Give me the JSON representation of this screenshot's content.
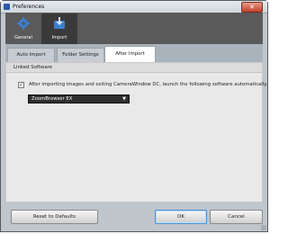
{
  "window": {
    "title": "Preferences",
    "close_glyph": "✕"
  },
  "main_tabs": [
    {
      "label": "General",
      "icon": "gear-icon"
    },
    {
      "label": "Import",
      "icon": "import-icon"
    }
  ],
  "sub_tabs": [
    {
      "label": "Auto Import"
    },
    {
      "label": "Folder Settings"
    },
    {
      "label": "After Import"
    }
  ],
  "panel": {
    "section_title": "Linked Software",
    "checkbox_label": "After importing images and exiting CameraWindow DC, launch the following software automatically.",
    "checkbox_checked": true,
    "checkbox_glyph": "✓",
    "software_select": {
      "value": "ZoomBrowser EX",
      "arrow": "▼"
    }
  },
  "buttons": {
    "reset": "Reset to Defaults",
    "ok": "OK",
    "cancel": "Cancel"
  }
}
